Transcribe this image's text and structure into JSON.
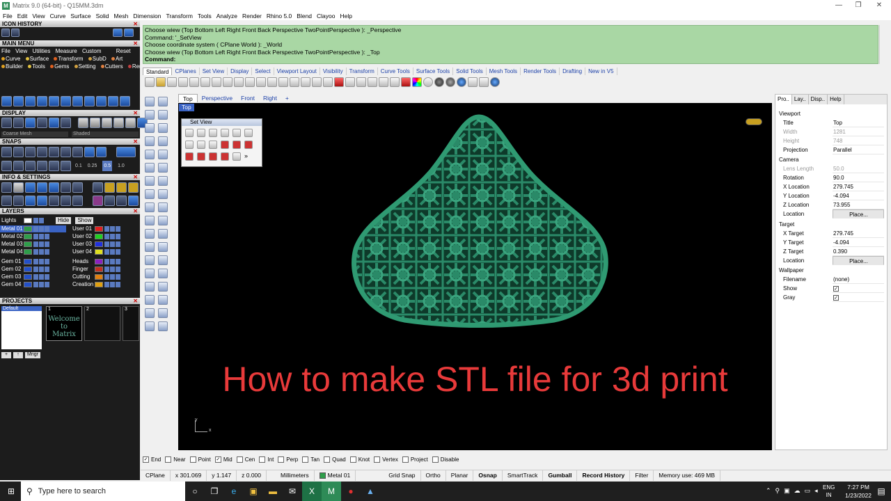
{
  "window": {
    "title": "Matrix 9.0 (64-bit) - Q15MM.3dm"
  },
  "menu": [
    "File",
    "Edit",
    "View",
    "Curve",
    "Surface",
    "Solid",
    "Mesh",
    "Dimension",
    "Transform",
    "Tools",
    "Analyze",
    "Render",
    "Rhino 5.0",
    "Blend",
    "Clayoo",
    "Help"
  ],
  "left_panel": {
    "icon_history": "ICON HISTORY",
    "main_menu": "MAIN MENU",
    "main_menu_row1": [
      "File",
      "View",
      "Utilities",
      "Measure",
      "Custom",
      "Reset"
    ],
    "main_menu_row2": [
      "Curve",
      "Surface",
      "Transform",
      "SubD",
      "Art"
    ],
    "main_menu_row3": [
      "Builder",
      "Tools",
      "Gems",
      "Setting",
      "Cutters",
      "Render"
    ],
    "display": "DISPLAY",
    "display_mode_1": "Coarse Mesh",
    "display_mode_2": "Shaded",
    "snaps": "SNAPS",
    "snap_values": [
      "0.1",
      "0.25",
      "0.5",
      "1.0"
    ],
    "info_settings": "INFO & SETTINGS",
    "layers": "LAYERS",
    "lights": "Lights",
    "hide": "Hide",
    "show": "Show",
    "layers_left": [
      "Metal 01",
      "Metal 02",
      "Metal 03",
      "Metal 04",
      "Gem 01",
      "Gem 02",
      "Gem 03",
      "Gem 04"
    ],
    "layers_right": [
      "User 01",
      "User 02",
      "User 03",
      "User 04",
      "Heads",
      "Finger",
      "Cutting",
      "Creation"
    ],
    "projects": "PROJECTS",
    "project_default": "Default",
    "project_slots": [
      "1",
      "2",
      "3"
    ],
    "welcome": "Welcome to Matrix",
    "mngr": "Mngr"
  },
  "command": {
    "lines": [
      "Choose wiew (Top Bottom Left Right Front Back Perspective TwoPointPerspective ): _Perspective",
      "Command: '_SetView",
      "Choose coordinate system ( CPlane World ): _World",
      "Choose wiew (Top Bottom Left Right Front Back Perspective TwoPointPerspective ): _Top"
    ],
    "prompt": "Command:"
  },
  "tabs": [
    "Standard",
    "CPlanes",
    "Set View",
    "Display",
    "Select",
    "Viewport Layout",
    "Visibility",
    "Transform",
    "Curve Tools",
    "Surface Tools",
    "Solid Tools",
    "Mesh Tools",
    "Render Tools",
    "Drafting",
    "New in V5"
  ],
  "viewport_tabs": [
    "Top",
    "Perspective",
    "Front",
    "Right",
    "+"
  ],
  "viewport": {
    "label": "Top",
    "setview_title": "Set View",
    "headline": "How to make STL file for 3d print",
    "axis_y": "y",
    "axis_x": "x",
    "model_color": "#2a8a68"
  },
  "props": {
    "tabs": [
      "Pro..",
      "Lay..",
      "Disp..",
      "Help"
    ],
    "viewport_section": "Viewport",
    "title_k": "Title",
    "title_v": "Top",
    "width_k": "Width",
    "width_v": "1281",
    "height_k": "Height",
    "height_v": "748",
    "projection_k": "Projection",
    "projection_v": "Parallel",
    "camera_section": "Camera",
    "lens_k": "Lens Length",
    "lens_v": "50.0",
    "rotation_k": "Rotation",
    "rotation_v": "90.0",
    "xloc_k": "X Location",
    "xloc_v": "279.745",
    "yloc_k": "Y Location",
    "yloc_v": "-4.094",
    "zloc_k": "Z Location",
    "zloc_v": "73.955",
    "location_k": "Location",
    "place_label": "Place...",
    "target_section": "Target",
    "xt_k": "X Target",
    "xt_v": "279.745",
    "yt_k": "Y Target",
    "yt_v": "-4.094",
    "zt_k": "Z Target",
    "zt_v": "0.390",
    "tlocation_k": "Location",
    "wallpaper_section": "Wallpaper",
    "filename_k": "Filename",
    "filename_v": "(none)",
    "show_k": "Show",
    "gray_k": "Gray"
  },
  "osnaps": [
    {
      "label": "End",
      "checked": true
    },
    {
      "label": "Near",
      "checked": false
    },
    {
      "label": "Point",
      "checked": false
    },
    {
      "label": "Mid",
      "checked": true
    },
    {
      "label": "Cen",
      "checked": false
    },
    {
      "label": "Int",
      "checked": false
    },
    {
      "label": "Perp",
      "checked": false
    },
    {
      "label": "Tan",
      "checked": false
    },
    {
      "label": "Quad",
      "checked": false
    },
    {
      "label": "Knot",
      "checked": false
    },
    {
      "label": "Vertex",
      "checked": false
    },
    {
      "label": "Project",
      "checked": false
    },
    {
      "label": "Disable",
      "checked": false
    }
  ],
  "status": {
    "cplane": "CPlane",
    "x": "x 301.069",
    "y": "y 1.147",
    "z": "z 0.000",
    "units": "Millimeters",
    "layer": "Metal 01",
    "layer_color": "#2e9e4a",
    "grid_snap": "Grid Snap",
    "ortho": "Ortho",
    "planar": "Planar",
    "osnap": "Osnap",
    "smarttrack": "SmartTrack",
    "gumball": "Gumball",
    "record_history": "Record History",
    "filter": "Filter",
    "memory": "Memory use: 469 MB"
  },
  "taskbar": {
    "search_placeholder": "Type here to search",
    "lang1": "ENG",
    "lang2": "IN",
    "time": "7:27 PM",
    "date": "1/23/2022"
  }
}
